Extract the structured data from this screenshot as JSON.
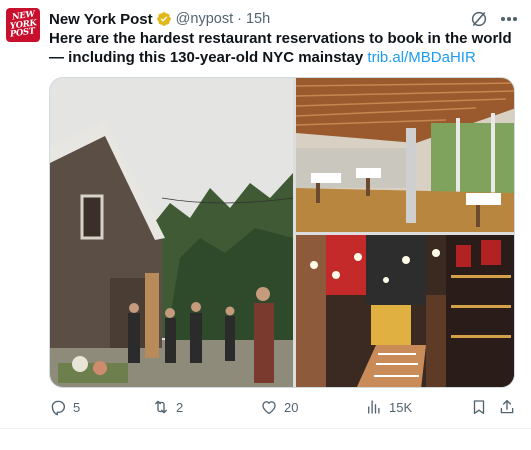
{
  "account": {
    "name": "New York Post",
    "handle": "@nypost",
    "separator": "·",
    "time": "15h",
    "avatar_text": [
      "NEW",
      "YORK",
      "POST"
    ],
    "avatar_color": "#c8102e",
    "verified_badge_color": "#e2b719"
  },
  "tweet": {
    "text": "Here are the hardest restaurant reservations to book in the world — including this 130-year-old NYC mainstay",
    "link": "trib.al/MBDaHIR"
  },
  "media": {
    "images": [
      "outdoor-barn-party-photo",
      "modern-dining-room-photo",
      "red-wine-bar-dining-photo"
    ]
  },
  "actions": {
    "replies": "5",
    "reposts": "2",
    "likes": "20",
    "views": "15K"
  },
  "icons": [
    "verified-badge-icon",
    "grok-icon",
    "more-icon",
    "reply-icon",
    "repost-icon",
    "like-icon",
    "views-icon",
    "bookmark-icon",
    "share-icon"
  ],
  "colors": {
    "text": "#0f1419",
    "secondary": "#536471",
    "link": "#1d9bf0"
  }
}
